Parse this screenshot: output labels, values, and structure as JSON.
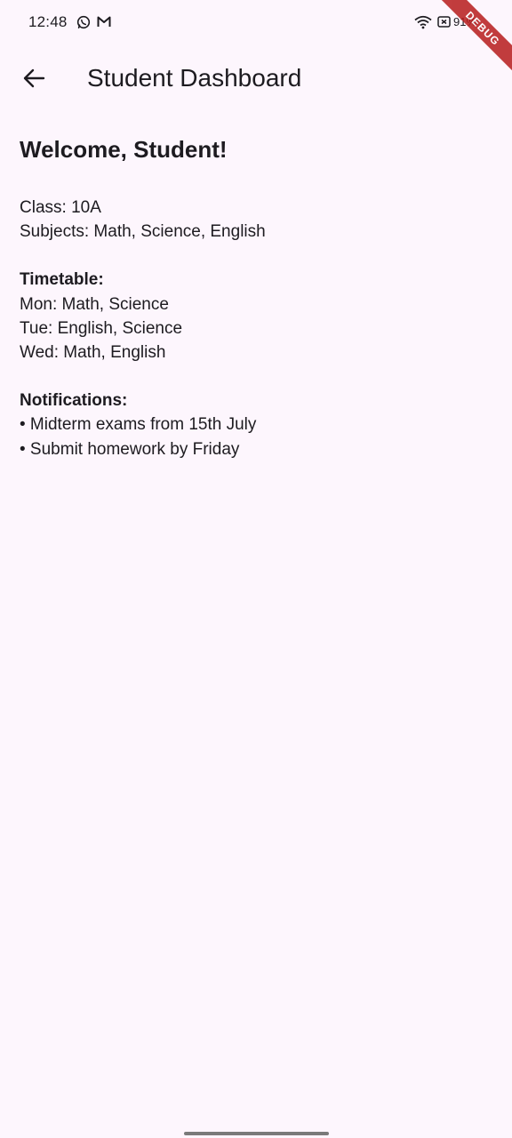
{
  "status_bar": {
    "time": "12:48",
    "battery": "91%",
    "icons": [
      "whatsapp-icon",
      "gmail-icon",
      "wifi-icon",
      "battery-saver-icon",
      "battery-icon"
    ]
  },
  "debug_banner": "DEBUG",
  "app_bar": {
    "back_icon": "arrow-left-icon",
    "title": "Student Dashboard"
  },
  "content": {
    "welcome": "Welcome, Student!",
    "class_line": "Class: 10A",
    "subjects_line": "Subjects: Math, Science, English",
    "timetable": {
      "heading": "Timetable:",
      "rows": [
        "Mon: Math, Science",
        "Tue: English, Science",
        "Wed: Math, English"
      ]
    },
    "notifications": {
      "heading": "Notifications:",
      "items": [
        "• Midterm exams from 15th July",
        "• Submit homework by Friday"
      ]
    }
  },
  "colors": {
    "background": "#fdf6fd",
    "text": "#1d1b20",
    "debug_banner": "#b71c1c"
  }
}
